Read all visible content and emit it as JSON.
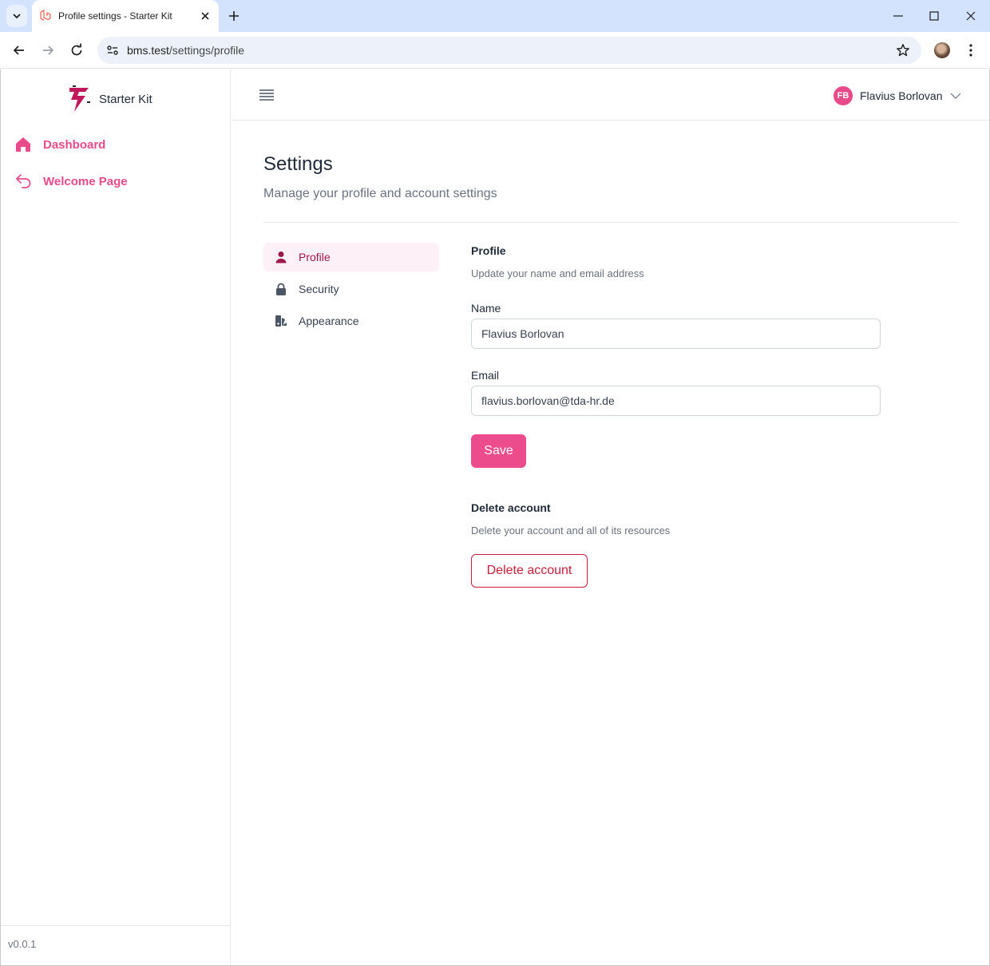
{
  "browser": {
    "tab_title": "Profile settings - Starter Kit",
    "url_host": "bms.test",
    "url_path": "/settings/profile"
  },
  "sidebar": {
    "brand_name": "Starter Kit",
    "items": [
      {
        "label": "Dashboard",
        "icon": "home-icon"
      },
      {
        "label": "Welcome Page",
        "icon": "return-arrow-icon"
      }
    ],
    "version": "v0.0.1"
  },
  "topbar": {
    "user_initials": "FB",
    "user_name": "Flavius Borlovan"
  },
  "settings": {
    "title": "Settings",
    "subtitle": "Manage your profile and account settings",
    "nav": [
      {
        "label": "Profile",
        "icon": "user-icon",
        "active": true
      },
      {
        "label": "Security",
        "icon": "lock-icon",
        "active": false
      },
      {
        "label": "Appearance",
        "icon": "palette-icon",
        "active": false
      }
    ]
  },
  "profile": {
    "title": "Profile",
    "description": "Update your name and email address",
    "name_label": "Name",
    "name_value": "Flavius Borlovan",
    "email_label": "Email",
    "email_value": "flavius.borlovan@tda-hr.de",
    "save_label": "Save"
  },
  "delete_account": {
    "title": "Delete account",
    "description": "Delete your account and all of its resources",
    "button_label": "Delete account"
  },
  "colors": {
    "accent": "#ec4c8b",
    "danger": "#c81e3a",
    "active_bg": "#fdf0f6",
    "tabbar_bg": "#d3e3fd"
  }
}
